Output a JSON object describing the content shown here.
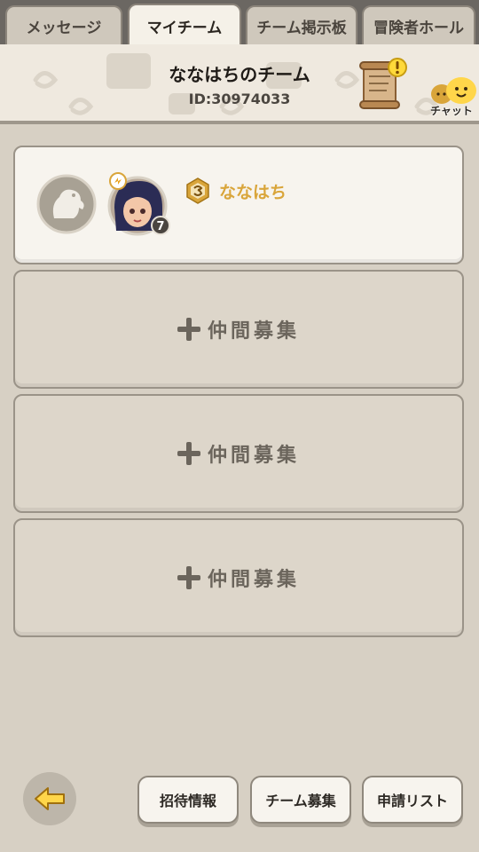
{
  "tabs": [
    {
      "label": "メッセージ",
      "active": false
    },
    {
      "label": "マイチーム",
      "active": true
    },
    {
      "label": "チーム掲示板",
      "active": false
    },
    {
      "label": "冒険者ホール",
      "active": false
    }
  ],
  "header": {
    "team_name": "ななはちのチーム",
    "team_id": "ID:30974033",
    "chat_label": "チャット",
    "scroll_icon": "team-notice-scroll-icon",
    "chat_icon": "chat-icon"
  },
  "members": [
    {
      "name": "ななはち",
      "level": "7",
      "badge_icon": "leader-badge-icon"
    }
  ],
  "recruit_slots": [
    {
      "label": "仲間募集"
    },
    {
      "label": "仲間募集"
    },
    {
      "label": "仲間募集"
    }
  ],
  "footer": {
    "back_icon": "back-arrow-icon",
    "buttons": [
      {
        "label": "招待情報"
      },
      {
        "label": "チーム募集"
      },
      {
        "label": "申請リスト"
      }
    ]
  },
  "colors": {
    "accent_gold": "#d9a53a",
    "background": "#d7d0c4",
    "tab_bar": "#6b6762"
  }
}
